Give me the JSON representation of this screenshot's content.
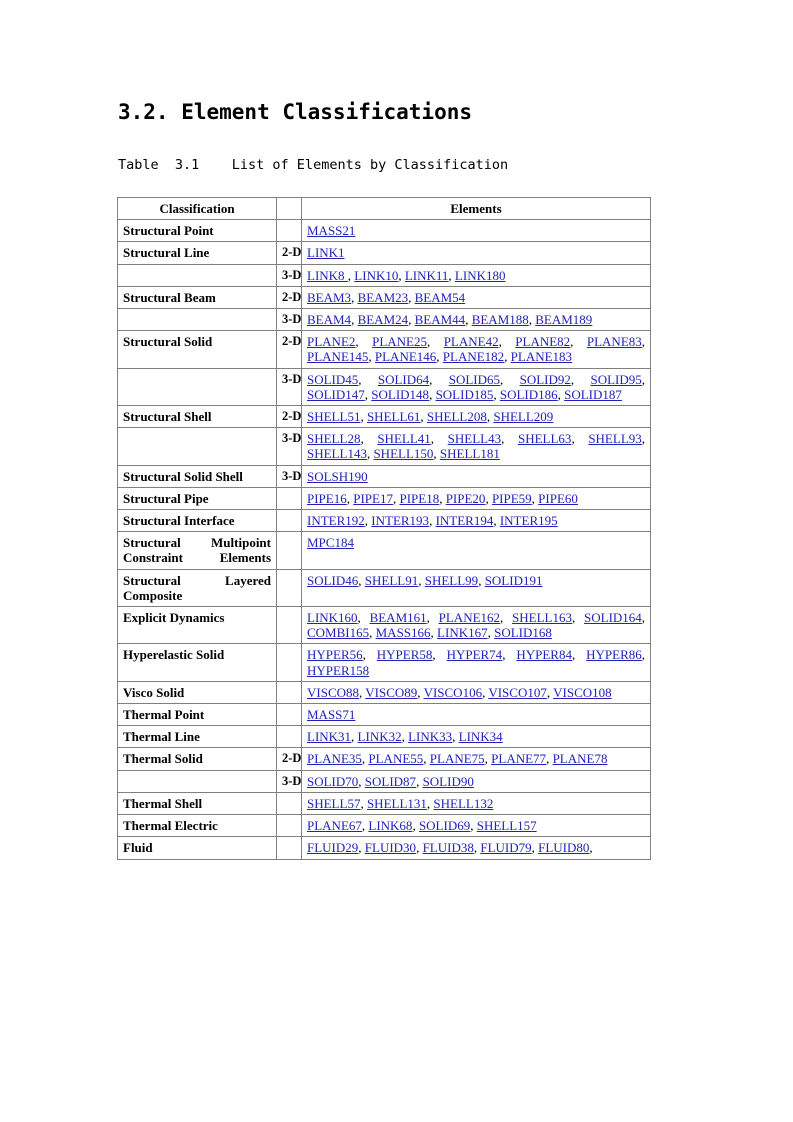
{
  "document": {
    "heading": "3.2. Element Classifications",
    "table_caption": "Table  3.1    List of Elements by Classification"
  },
  "table": {
    "headers": {
      "classification": "Classification",
      "dimension": "",
      "elements": "Elements"
    },
    "rows": [
      {
        "classification": "Structural Point",
        "dim": "",
        "elements": [
          "MASS21"
        ]
      },
      {
        "classification": "Structural Line",
        "dim": "2-D",
        "elements": [
          "LINK1"
        ]
      },
      {
        "classification": "",
        "dim": "3-D",
        "elements": [
          "LINK8 ",
          "LINK10",
          "LINK11",
          "LINK180"
        ]
      },
      {
        "classification": "Structural Beam",
        "dim": "2-D",
        "elements": [
          "BEAM3",
          "BEAM23",
          "BEAM54"
        ]
      },
      {
        "classification": "",
        "dim": "3-D",
        "elements": [
          "BEAM4",
          "BEAM24",
          "BEAM44",
          "BEAM188",
          "BEAM189"
        ]
      },
      {
        "classification": "Structural Solid",
        "dim": "2-D",
        "elements": [
          "PLANE2",
          "PLANE25",
          "PLANE42",
          "PLANE82",
          "PLANE83",
          "PLANE145",
          "PLANE146",
          "PLANE182",
          "PLANE183"
        ]
      },
      {
        "classification": "",
        "dim": "3-D",
        "elements": [
          "SOLID45",
          "SOLID64",
          "SOLID65",
          "SOLID92",
          "SOLID95",
          "SOLID147",
          "SOLID148",
          "SOLID185",
          "SOLID186",
          "SOLID187"
        ]
      },
      {
        "classification": "Structural Shell",
        "dim": "2-D",
        "elements": [
          "SHELL51",
          "SHELL61",
          "SHELL208",
          "SHELL209"
        ]
      },
      {
        "classification": "",
        "dim": "3-D",
        "elements": [
          "SHELL28",
          "SHELL41",
          "SHELL43",
          "SHELL63",
          "SHELL93",
          "SHELL143",
          "SHELL150",
          "SHELL181"
        ]
      },
      {
        "classification": "Structural Solid Shell",
        "dim": "3-D",
        "elements": [
          "SOLSH190"
        ]
      },
      {
        "classification": "Structural Pipe",
        "dim": "",
        "elements": [
          "PIPE16",
          "PIPE17",
          "PIPE18",
          "PIPE20",
          "PIPE59",
          "PIPE60"
        ]
      },
      {
        "classification": "Structural Interface",
        "dim": "",
        "elements": [
          "INTER192",
          "INTER193",
          "INTER194",
          "INTER195"
        ]
      },
      {
        "classification": "Structural Multipoint Constraint Elements",
        "dim": "",
        "elements": [
          "MPC184"
        ]
      },
      {
        "classification": "Structural Layered Composite",
        "dim": "",
        "elements": [
          "SOLID46",
          "SHELL91",
          "SHELL99",
          "SOLID191"
        ]
      },
      {
        "classification": "Explicit Dynamics",
        "dim": "",
        "elements": [
          "LINK160",
          "BEAM161",
          "PLANE162",
          "SHELL163",
          "SOLID164",
          "COMBI165",
          "MASS166",
          "LINK167",
          "SOLID168"
        ]
      },
      {
        "classification": "Hyperelastic Solid",
        "dim": "",
        "elements": [
          "HYPER56",
          "HYPER58",
          "HYPER74",
          "HYPER84",
          "HYPER86",
          "HYPER158"
        ]
      },
      {
        "classification": "Visco Solid",
        "dim": "",
        "elements": [
          "VISCO88",
          "VISCO89",
          "VISCO106",
          "VISCO107",
          "VISCO108"
        ]
      },
      {
        "classification": "Thermal Point",
        "dim": "",
        "elements": [
          "MASS71"
        ]
      },
      {
        "classification": "Thermal Line",
        "dim": "",
        "elements": [
          "LINK31",
          "LINK32",
          "LINK33",
          "LINK34"
        ]
      },
      {
        "classification": "Thermal Solid",
        "dim": "2-D",
        "elements": [
          "PLANE35",
          "PLANE55",
          "PLANE75",
          "PLANE77",
          "PLANE78"
        ]
      },
      {
        "classification": "",
        "dim": "3-D",
        "elements": [
          "SOLID70",
          "SOLID87",
          "SOLID90"
        ]
      },
      {
        "classification": "Thermal Shell",
        "dim": "",
        "elements": [
          "SHELL57",
          "SHELL131",
          "SHELL132"
        ]
      },
      {
        "classification": "Thermal Electric",
        "dim": "",
        "elements": [
          "PLANE67",
          "LINK68",
          "SOLID69",
          "SHELL157"
        ]
      },
      {
        "classification": "Fluid",
        "dim": "",
        "elements": [
          "FLUID29",
          "FLUID30",
          "FLUID38",
          "FLUID79",
          "FLUID80"
        ],
        "trailing_comma": true
      }
    ]
  },
  "colors": {
    "link": "#2222bb",
    "text": "#000000",
    "border": "#808080",
    "background": "#ffffff"
  }
}
